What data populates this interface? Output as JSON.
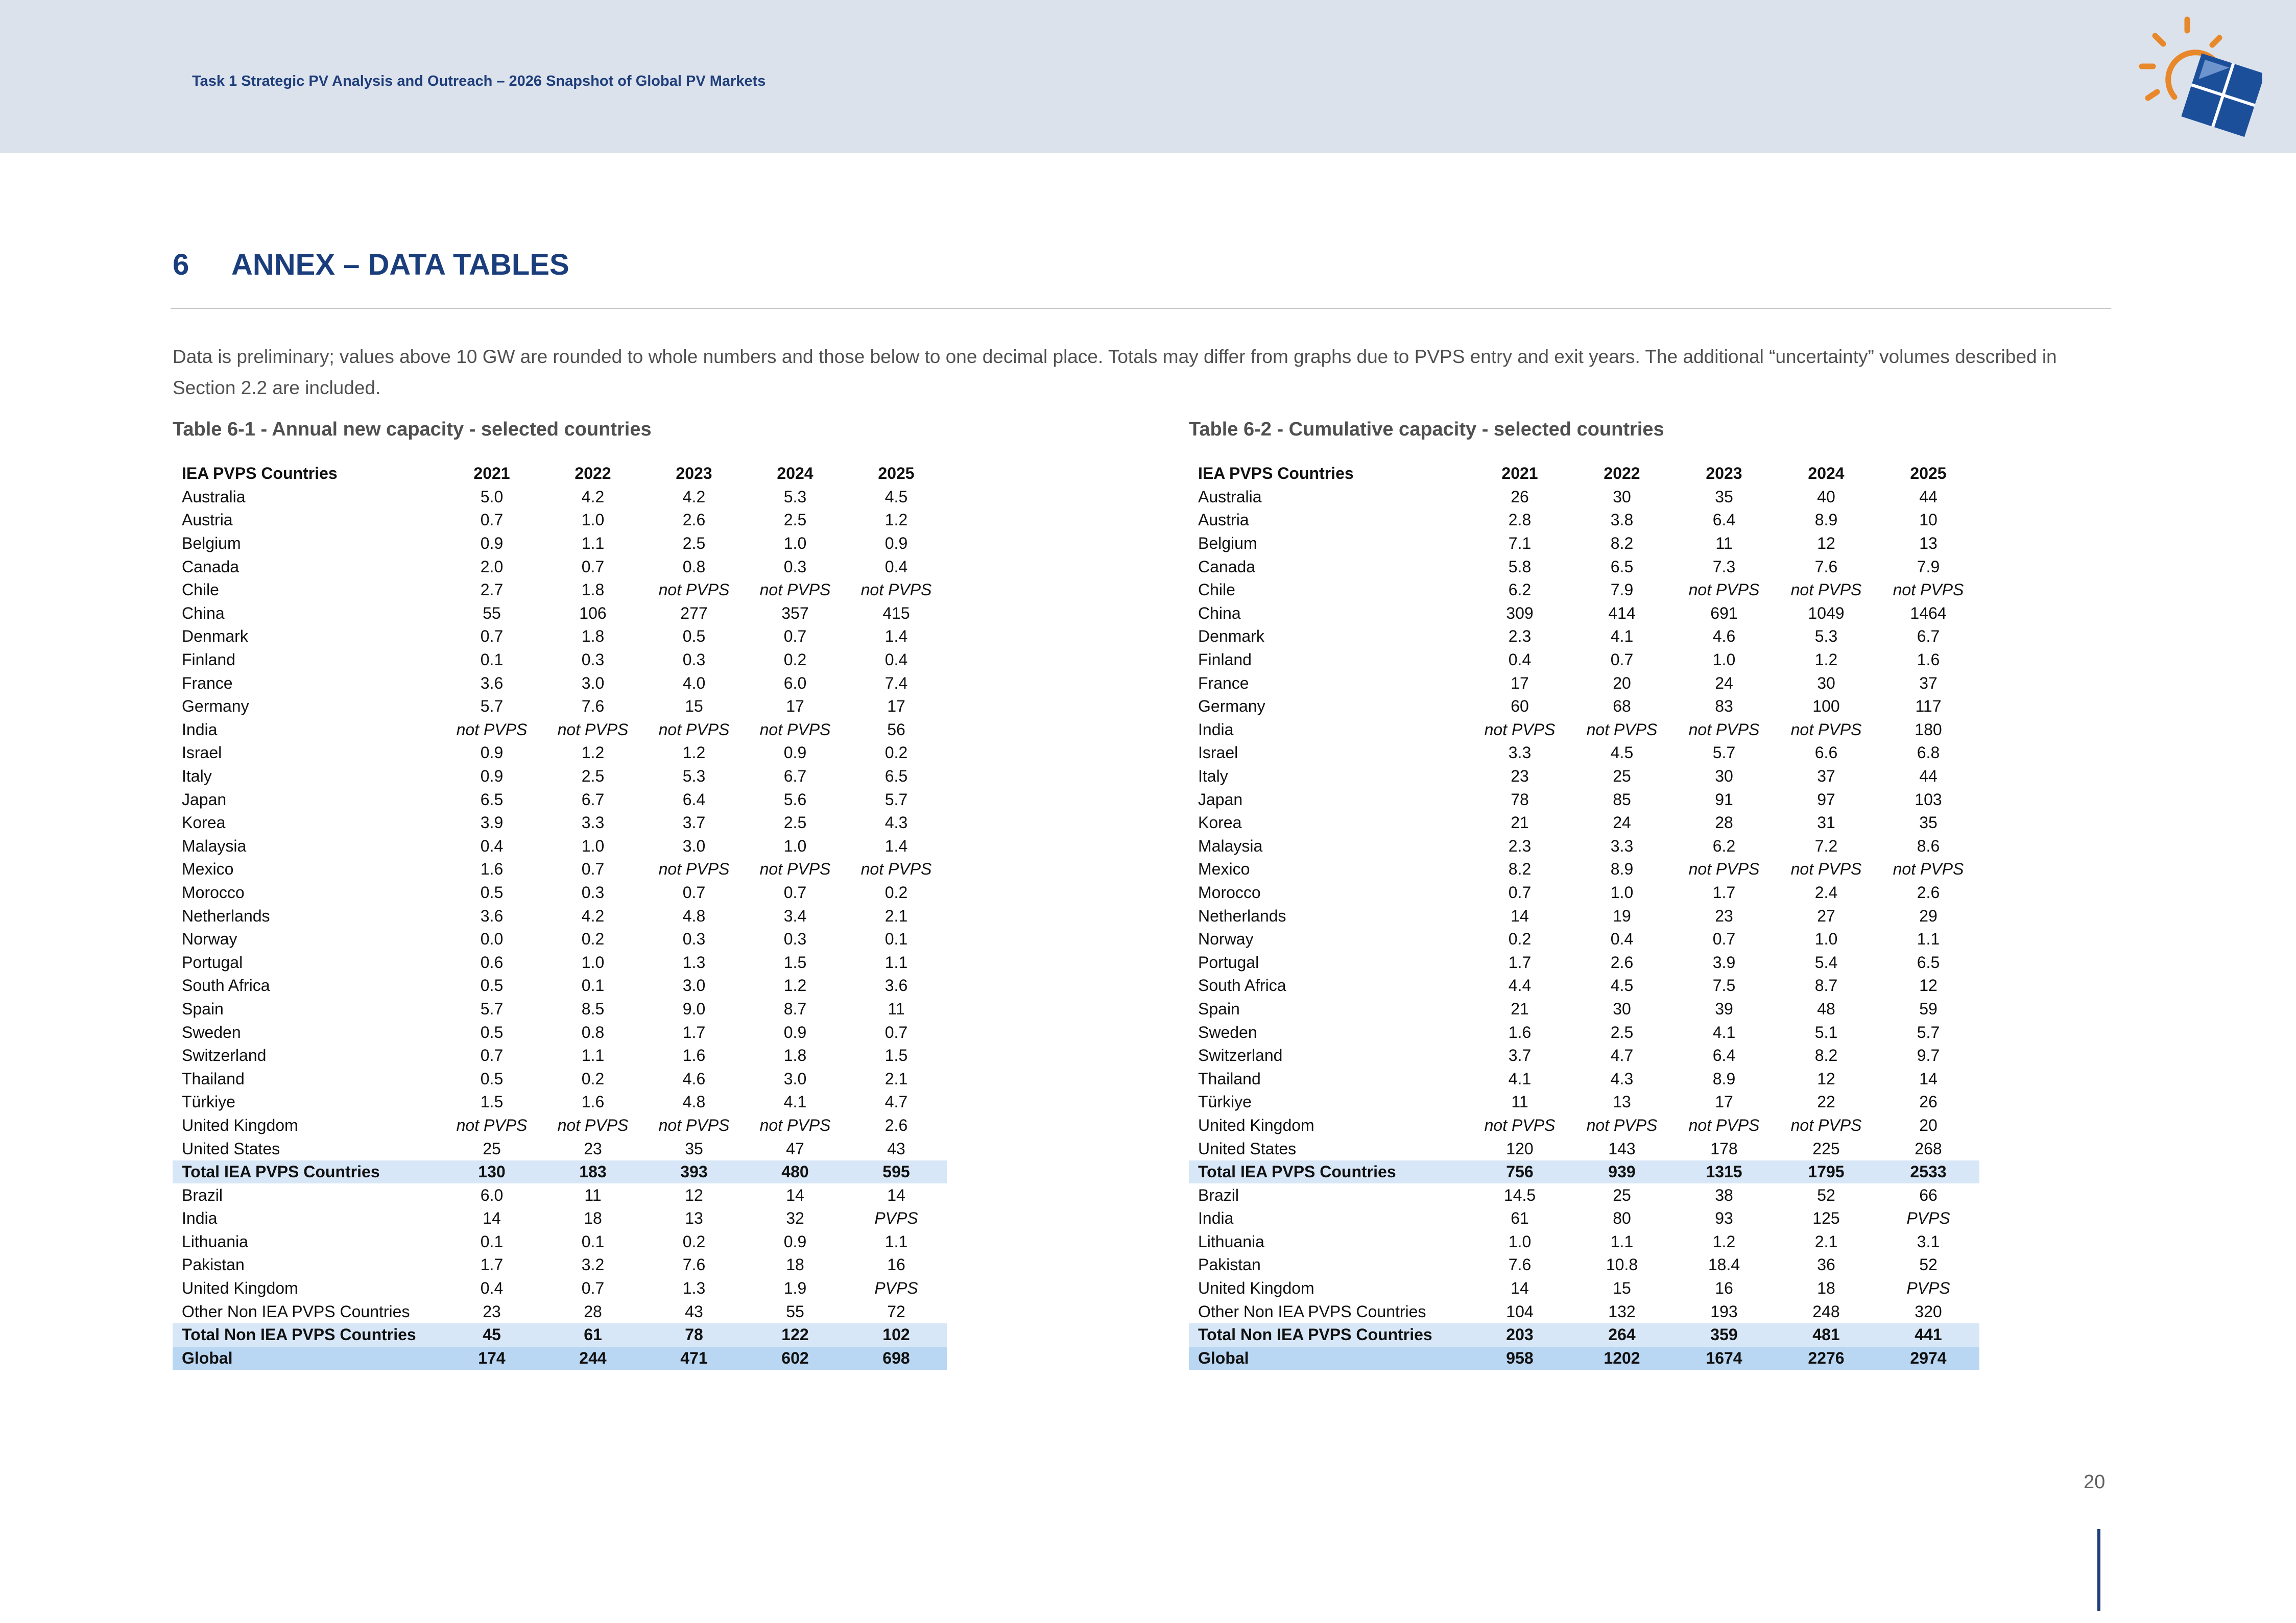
{
  "header": {
    "text": "Task 1 Strategic PV Analysis and Outreach – 2026 Snapshot of Global PV Markets"
  },
  "section": {
    "number": "6",
    "title": "ANNEX – DATA TABLES"
  },
  "intro": "Data is preliminary; values above 10 GW are rounded to whole numbers and those below to one decimal place. Totals may differ from graphs due to PVPS entry and exit years. The additional “uncertainty” volumes described in Section 2.2 are included.",
  "tables": [
    {
      "caption": "Table 6-1 - Annual new capacity - selected countries",
      "columns": [
        "IEA PVPS Countries",
        "2021",
        "2022",
        "2023",
        "2024",
        "2025"
      ],
      "rows": [
        {
          "cells": [
            "Australia",
            "5.0",
            "4.2",
            "4.2",
            "5.3",
            "4.5"
          ]
        },
        {
          "cells": [
            "Austria",
            "0.7",
            "1.0",
            "2.6",
            "2.5",
            "1.2"
          ]
        },
        {
          "cells": [
            "Belgium",
            "0.9",
            "1.1",
            "2.5",
            "1.0",
            "0.9"
          ]
        },
        {
          "cells": [
            "Canada",
            "2.0",
            "0.7",
            "0.8",
            "0.3",
            "0.4"
          ]
        },
        {
          "cells": [
            "Chile",
            "2.7",
            "1.8",
            "not PVPS",
            "not PVPS",
            "not PVPS"
          ]
        },
        {
          "cells": [
            "China",
            "55",
            "106",
            "277",
            "357",
            "415"
          ]
        },
        {
          "cells": [
            "Denmark",
            "0.7",
            "1.8",
            "0.5",
            "0.7",
            "1.4"
          ]
        },
        {
          "cells": [
            "Finland",
            "0.1",
            "0.3",
            "0.3",
            "0.2",
            "0.4"
          ]
        },
        {
          "cells": [
            "France",
            "3.6",
            "3.0",
            "4.0",
            "6.0",
            "7.4"
          ]
        },
        {
          "cells": [
            "Germany",
            "5.7",
            "7.6",
            "15",
            "17",
            "17"
          ]
        },
        {
          "cells": [
            "India",
            "not PVPS",
            "not PVPS",
            "not PVPS",
            "not PVPS",
            "56"
          ]
        },
        {
          "cells": [
            "Israel",
            "0.9",
            "1.2",
            "1.2",
            "0.9",
            "0.2"
          ]
        },
        {
          "cells": [
            "Italy",
            "0.9",
            "2.5",
            "5.3",
            "6.7",
            "6.5"
          ]
        },
        {
          "cells": [
            "Japan",
            "6.5",
            "6.7",
            "6.4",
            "5.6",
            "5.7"
          ]
        },
        {
          "cells": [
            "Korea",
            "3.9",
            "3.3",
            "3.7",
            "2.5",
            "4.3"
          ]
        },
        {
          "cells": [
            "Malaysia",
            "0.4",
            "1.0",
            "3.0",
            "1.0",
            "1.4"
          ]
        },
        {
          "cells": [
            "Mexico",
            "1.6",
            "0.7",
            "not PVPS",
            "not PVPS",
            "not PVPS"
          ]
        },
        {
          "cells": [
            "Morocco",
            "0.5",
            "0.3",
            "0.7",
            "0.7",
            "0.2"
          ]
        },
        {
          "cells": [
            "Netherlands",
            "3.6",
            "4.2",
            "4.8",
            "3.4",
            "2.1"
          ]
        },
        {
          "cells": [
            "Norway",
            "0.0",
            "0.2",
            "0.3",
            "0.3",
            "0.1"
          ]
        },
        {
          "cells": [
            "Portugal",
            "0.6",
            "1.0",
            "1.3",
            "1.5",
            "1.1"
          ]
        },
        {
          "cells": [
            "South Africa",
            "0.5",
            "0.1",
            "3.0",
            "1.2",
            "3.6"
          ]
        },
        {
          "cells": [
            "Spain",
            "5.7",
            "8.5",
            "9.0",
            "8.7",
            "11"
          ]
        },
        {
          "cells": [
            "Sweden",
            "0.5",
            "0.8",
            "1.7",
            "0.9",
            "0.7"
          ]
        },
        {
          "cells": [
            "Switzerland",
            "0.7",
            "1.1",
            "1.6",
            "1.8",
            "1.5"
          ]
        },
        {
          "cells": [
            "Thailand",
            "0.5",
            "0.2",
            "4.6",
            "3.0",
            "2.1"
          ]
        },
        {
          "cells": [
            "Türkiye",
            "1.5",
            "1.6",
            "4.8",
            "4.1",
            "4.7"
          ]
        },
        {
          "cells": [
            "United Kingdom",
            "not PVPS",
            "not PVPS",
            "not PVPS",
            "not PVPS",
            "2.6"
          ]
        },
        {
          "cells": [
            "United States",
            "25",
            "23",
            "35",
            "47",
            "43"
          ]
        },
        {
          "type": "total",
          "cells": [
            "Total IEA PVPS Countries",
            "130",
            "183",
            "393",
            "480",
            "595"
          ]
        },
        {
          "cells": [
            "Brazil",
            "6.0",
            "11",
            "12",
            "14",
            "14"
          ]
        },
        {
          "cells": [
            "India",
            "14",
            "18",
            "13",
            "32",
            "PVPS"
          ]
        },
        {
          "cells": [
            "Lithuania",
            "0.1",
            "0.1",
            "0.2",
            "0.9",
            "1.1"
          ]
        },
        {
          "cells": [
            "Pakistan",
            "1.7",
            "3.2",
            "7.6",
            "18",
            "16"
          ]
        },
        {
          "cells": [
            "United Kingdom",
            "0.4",
            "0.7",
            "1.3",
            "1.9",
            "PVPS"
          ]
        },
        {
          "cells": [
            "Other Non IEA PVPS Countries",
            "23",
            "28",
            "43",
            "55",
            "72"
          ]
        },
        {
          "type": "total",
          "cells": [
            "Total Non IEA PVPS Countries",
            "45",
            "61",
            "78",
            "122",
            "102"
          ]
        },
        {
          "type": "global",
          "cells": [
            "Global",
            "174",
            "244",
            "471",
            "602",
            "698"
          ]
        }
      ]
    },
    {
      "caption": "Table 6-2 - Cumulative capacity - selected countries",
      "columns": [
        "IEA PVPS Countries",
        "2021",
        "2022",
        "2023",
        "2024",
        "2025"
      ],
      "rows": [
        {
          "cells": [
            "Australia",
            "26",
            "30",
            "35",
            "40",
            "44"
          ]
        },
        {
          "cells": [
            "Austria",
            "2.8",
            "3.8",
            "6.4",
            "8.9",
            "10"
          ]
        },
        {
          "cells": [
            "Belgium",
            "7.1",
            "8.2",
            "11",
            "12",
            "13"
          ]
        },
        {
          "cells": [
            "Canada",
            "5.8",
            "6.5",
            "7.3",
            "7.6",
            "7.9"
          ]
        },
        {
          "cells": [
            "Chile",
            "6.2",
            "7.9",
            "not PVPS",
            "not PVPS",
            "not PVPS"
          ]
        },
        {
          "cells": [
            "China",
            "309",
            "414",
            "691",
            "1049",
            "1464"
          ]
        },
        {
          "cells": [
            "Denmark",
            "2.3",
            "4.1",
            "4.6",
            "5.3",
            "6.7"
          ]
        },
        {
          "cells": [
            "Finland",
            "0.4",
            "0.7",
            "1.0",
            "1.2",
            "1.6"
          ]
        },
        {
          "cells": [
            "France",
            "17",
            "20",
            "24",
            "30",
            "37"
          ]
        },
        {
          "cells": [
            "Germany",
            "60",
            "68",
            "83",
            "100",
            "117"
          ]
        },
        {
          "cells": [
            "India",
            "not PVPS",
            "not PVPS",
            "not PVPS",
            "not PVPS",
            "180"
          ]
        },
        {
          "cells": [
            "Israel",
            "3.3",
            "4.5",
            "5.7",
            "6.6",
            "6.8"
          ]
        },
        {
          "cells": [
            "Italy",
            "23",
            "25",
            "30",
            "37",
            "44"
          ]
        },
        {
          "cells": [
            "Japan",
            "78",
            "85",
            "91",
            "97",
            "103"
          ]
        },
        {
          "cells": [
            "Korea",
            "21",
            "24",
            "28",
            "31",
            "35"
          ]
        },
        {
          "cells": [
            "Malaysia",
            "2.3",
            "3.3",
            "6.2",
            "7.2",
            "8.6"
          ]
        },
        {
          "cells": [
            "Mexico",
            "8.2",
            "8.9",
            "not PVPS",
            "not PVPS",
            "not PVPS"
          ]
        },
        {
          "cells": [
            "Morocco",
            "0.7",
            "1.0",
            "1.7",
            "2.4",
            "2.6"
          ]
        },
        {
          "cells": [
            "Netherlands",
            "14",
            "19",
            "23",
            "27",
            "29"
          ]
        },
        {
          "cells": [
            "Norway",
            "0.2",
            "0.4",
            "0.7",
            "1.0",
            "1.1"
          ]
        },
        {
          "cells": [
            "Portugal",
            "1.7",
            "2.6",
            "3.9",
            "5.4",
            "6.5"
          ]
        },
        {
          "cells": [
            "South Africa",
            "4.4",
            "4.5",
            "7.5",
            "8.7",
            "12"
          ]
        },
        {
          "cells": [
            "Spain",
            "21",
            "30",
            "39",
            "48",
            "59"
          ]
        },
        {
          "cells": [
            "Sweden",
            "1.6",
            "2.5",
            "4.1",
            "5.1",
            "5.7"
          ]
        },
        {
          "cells": [
            "Switzerland",
            "3.7",
            "4.7",
            "6.4",
            "8.2",
            "9.7"
          ]
        },
        {
          "cells": [
            "Thailand",
            "4.1",
            "4.3",
            "8.9",
            "12",
            "14"
          ]
        },
        {
          "cells": [
            "Türkiye",
            "11",
            "13",
            "17",
            "22",
            "26"
          ]
        },
        {
          "cells": [
            "United Kingdom",
            "not PVPS",
            "not PVPS",
            "not PVPS",
            "not PVPS",
            "20"
          ]
        },
        {
          "cells": [
            "United States",
            "120",
            "143",
            "178",
            "225",
            "268"
          ]
        },
        {
          "type": "total",
          "cells": [
            "Total IEA PVPS Countries",
            "756",
            "939",
            "1315",
            "1795",
            "2533"
          ]
        },
        {
          "cells": [
            "Brazil",
            "14.5",
            "25",
            "38",
            "52",
            "66"
          ]
        },
        {
          "cells": [
            "India",
            "61",
            "80",
            "93",
            "125",
            "PVPS"
          ]
        },
        {
          "cells": [
            "Lithuania",
            "1.0",
            "1.1",
            "1.2",
            "2.1",
            "3.1"
          ]
        },
        {
          "cells": [
            "Pakistan",
            "7.6",
            "10.8",
            "18.4",
            "36",
            "52"
          ]
        },
        {
          "cells": [
            "United Kingdom",
            "14",
            "15",
            "16",
            "18",
            "PVPS"
          ]
        },
        {
          "cells": [
            "Other Non IEA PVPS Countries",
            "104",
            "132",
            "193",
            "248",
            "320"
          ]
        },
        {
          "type": "total",
          "cells": [
            "Total Non IEA PVPS Countries",
            "203",
            "264",
            "359",
            "481",
            "441"
          ]
        },
        {
          "type": "global",
          "cells": [
            "Global",
            "958",
            "1202",
            "1674",
            "2276",
            "2974"
          ]
        }
      ]
    }
  ],
  "page_number": "20",
  "logo": {
    "icon": "sun-solar-panel-logo",
    "colors": {
      "sun": "#e8882a",
      "panel": "#1c4f9a"
    }
  }
}
